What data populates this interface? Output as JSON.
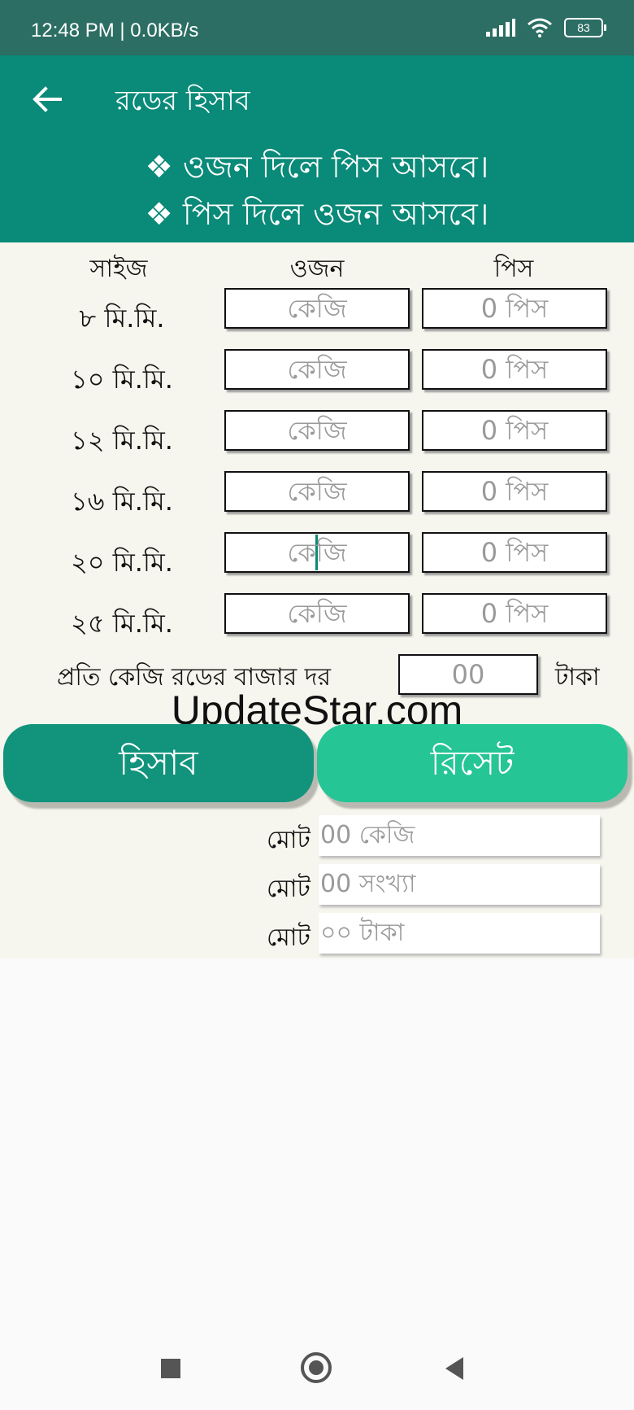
{
  "status": {
    "time": "12:48 PM | 0.0KB/s",
    "battery": "83"
  },
  "appbar": {
    "title": "রডের হিসাব"
  },
  "banner": {
    "line1": "❖ ওজন দিলে পিস আসবে।",
    "line2": "❖ পিস দিলে ওজন আসবে।"
  },
  "headers": {
    "size": "সাইজ",
    "weight": "ওজন",
    "piece": "পিস"
  },
  "rows": [
    {
      "size": "৮ মি.মি.",
      "weight_placeholder": "কেজি",
      "piece_placeholder": "0 পিস"
    },
    {
      "size": "১০ মি.মি.",
      "weight_placeholder": "কেজি",
      "piece_placeholder": "0 পিস"
    },
    {
      "size": "১২ মি.মি.",
      "weight_placeholder": "কেজি",
      "piece_placeholder": "0 পিস"
    },
    {
      "size": "১৬ মি.মি.",
      "weight_placeholder": "কেজি",
      "piece_placeholder": "0 পিস"
    },
    {
      "size": "২০ মি.মি.",
      "weight_placeholder_a": "কে",
      "weight_placeholder_b": "জি",
      "piece_placeholder": "0 পিস"
    },
    {
      "size": "২৫ মি.মি.",
      "weight_placeholder": "কেজি",
      "piece_placeholder": "0 পিস"
    }
  ],
  "rate": {
    "label": "প্রতি কেজি রডের বাজার দর",
    "placeholder": "00",
    "unit": "টাকা"
  },
  "watermark": "UpdateStar.com",
  "buttons": {
    "calculate": "হিসাব",
    "reset": "রিসেট"
  },
  "totals": [
    {
      "label": "মোট",
      "value": "00  কেজি"
    },
    {
      "label": "মোট",
      "value": "00  সংখ্যা"
    },
    {
      "label": "মোট",
      "value": "০০ টাকা"
    }
  ],
  "colors": {
    "primary": "#0a8a78",
    "status_bar": "#2c6e63",
    "calc_button": "#12947c",
    "reset_button": "#25c595",
    "content_bg": "#f6f6ee"
  }
}
